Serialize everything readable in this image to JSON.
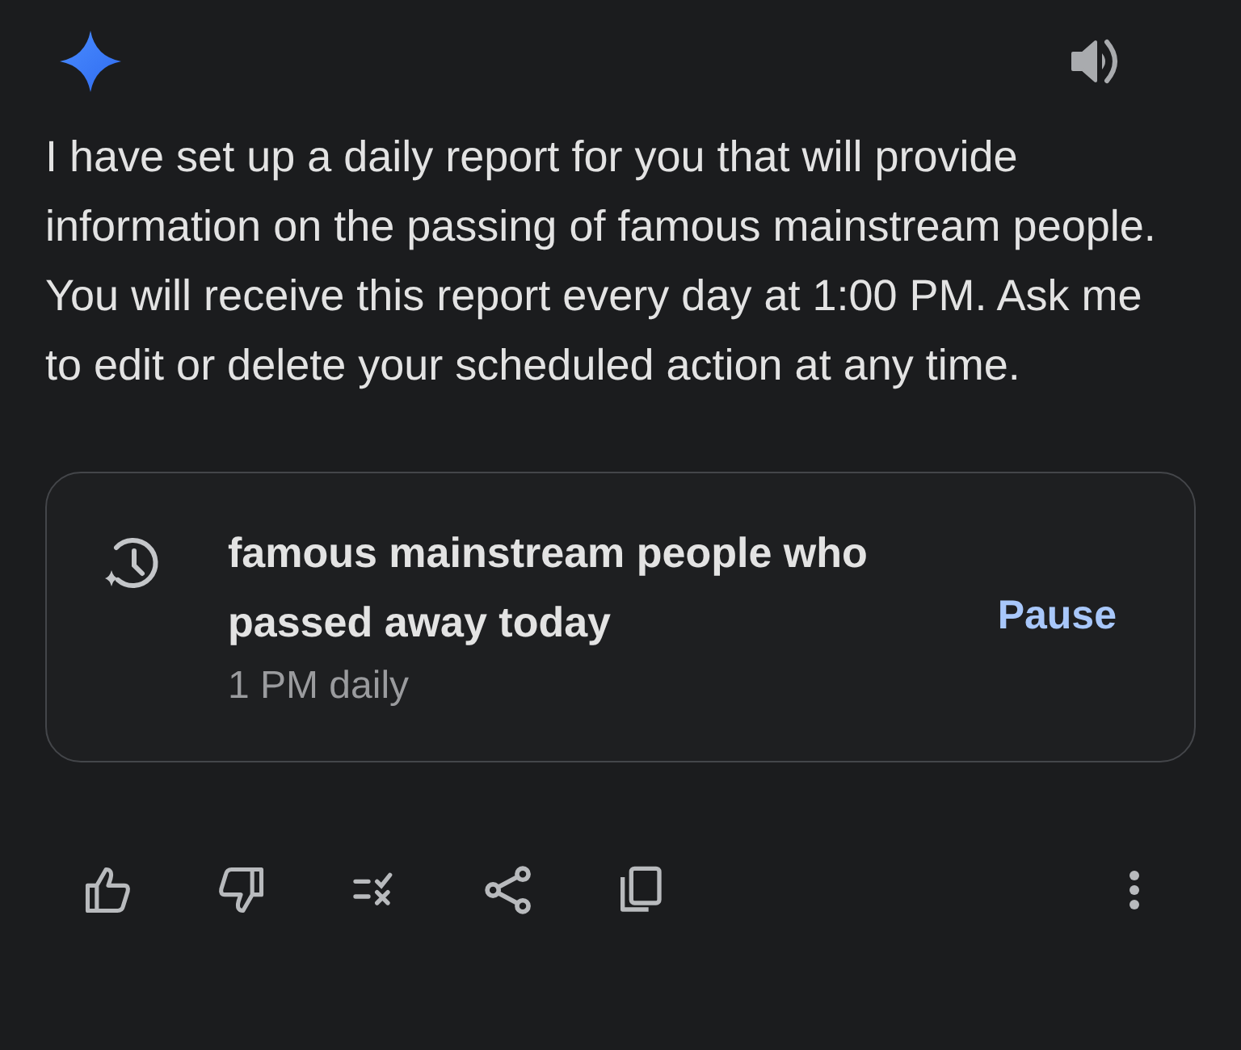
{
  "message": {
    "text": "I have set up a daily report for you that will provide information on the passing of famous mainstream people. You will receive this report every day at 1:00 PM. Ask me to edit or delete your scheduled action at any time."
  },
  "scheduled_action": {
    "title": "famous mainstream people who passed away today",
    "schedule": "1 PM daily",
    "action": "Pause"
  }
}
